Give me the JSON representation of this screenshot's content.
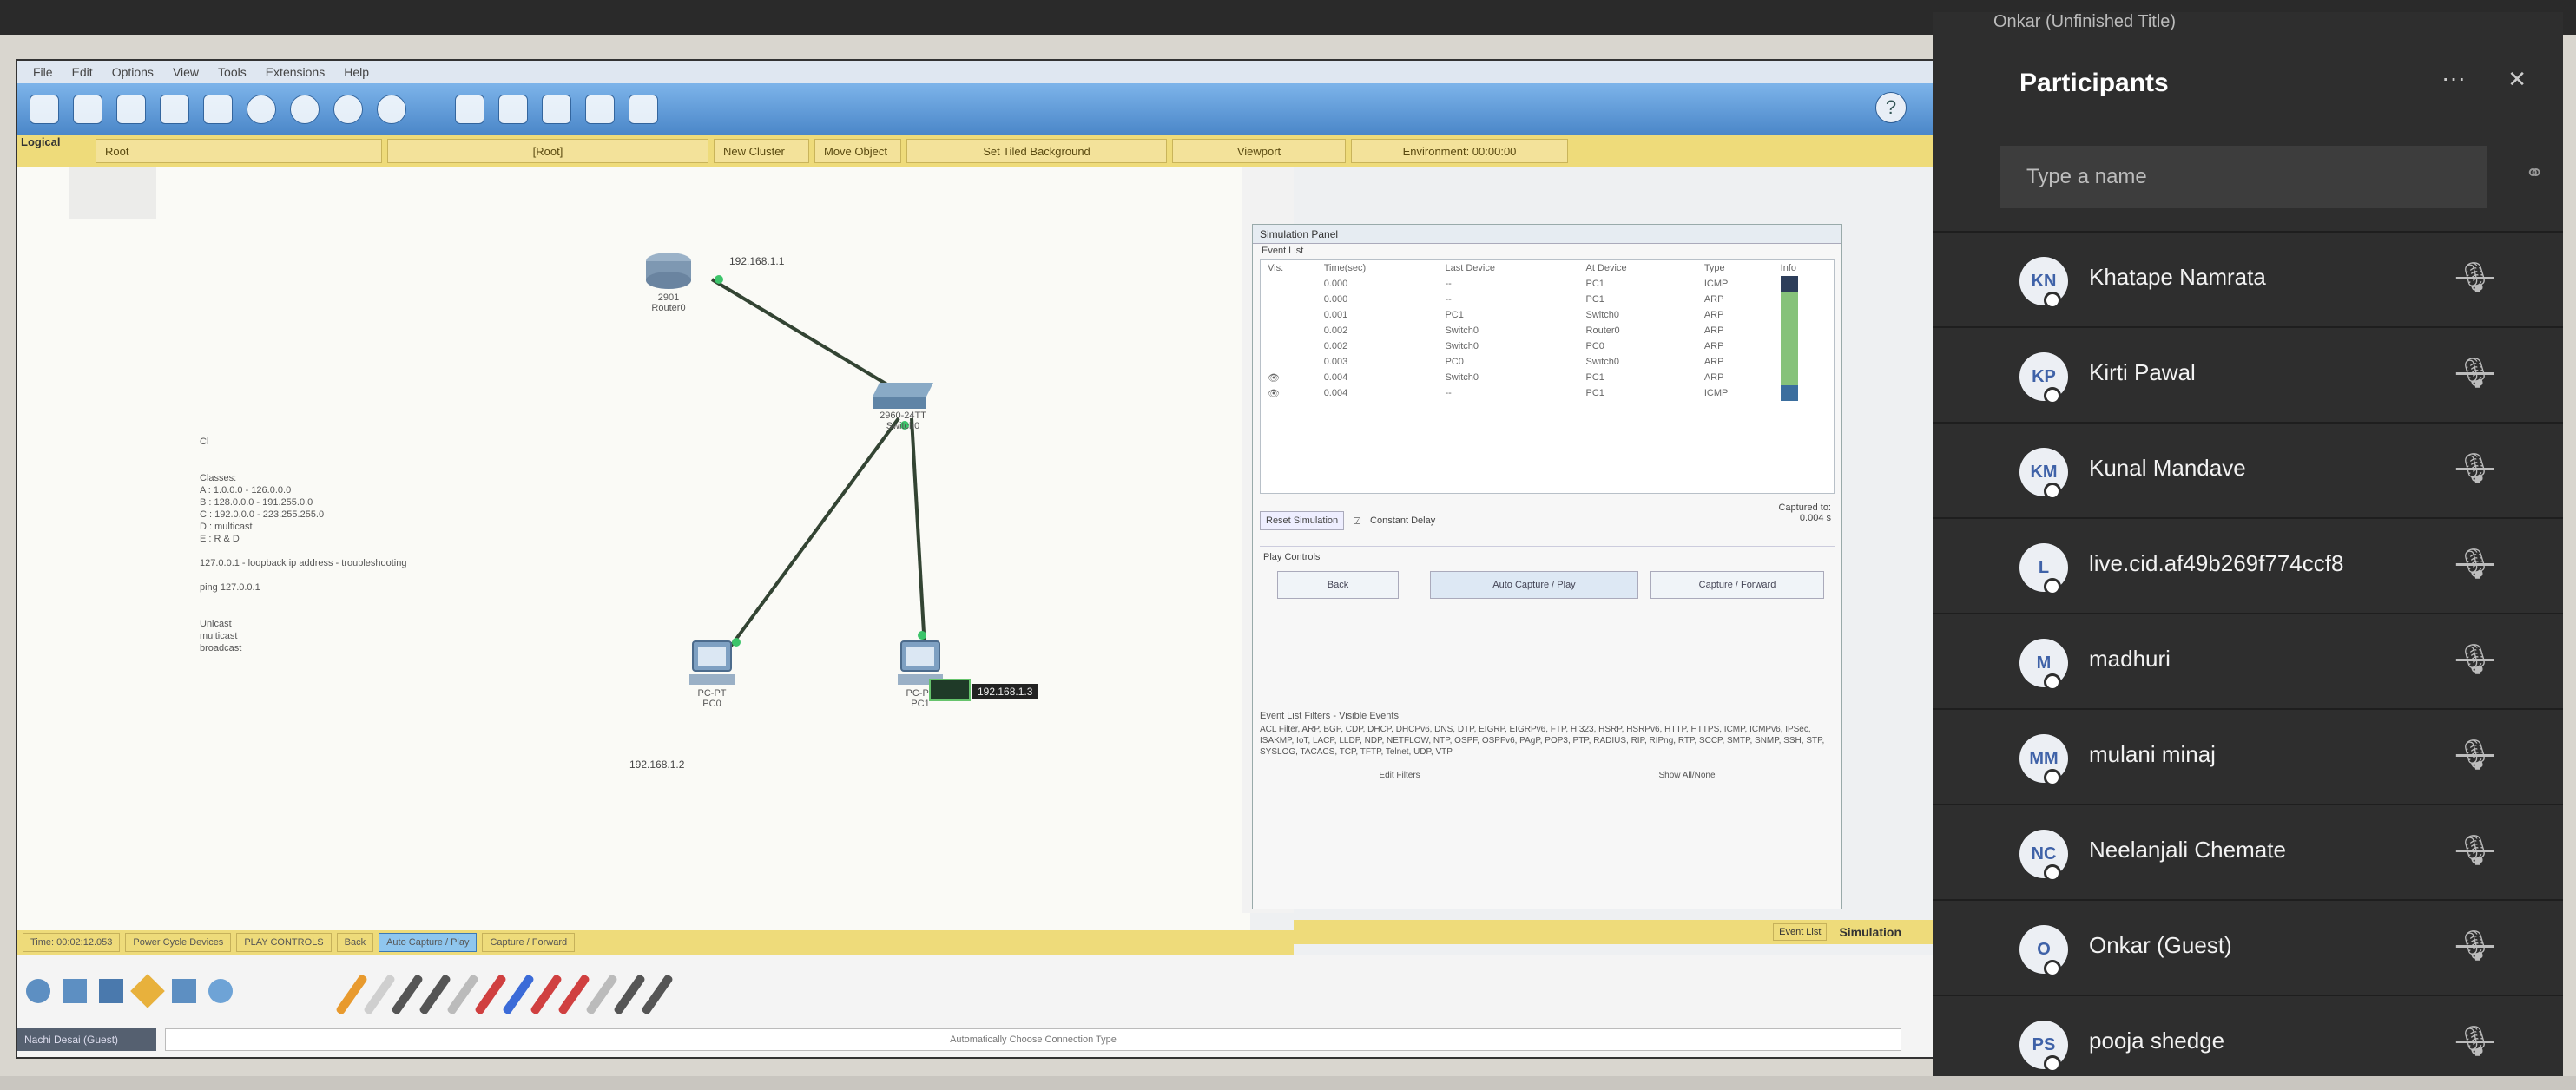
{
  "packet_tracer": {
    "menu": [
      "File",
      "Edit",
      "Options",
      "View",
      "Tools",
      "Extensions",
      "Help"
    ],
    "logical_label": "Logical",
    "toolbar_segments": [
      "Root",
      "[Root]",
      "New Cluster",
      "Move Object",
      "Set Tiled Background",
      "Viewport",
      "Environment: 00:00:00"
    ],
    "devices": {
      "router_model": "2901",
      "router_name": "Router0",
      "router_ip": "192.168.1.1",
      "switch_model": "2960-24TT",
      "switch_name": "Switch0",
      "pc0_model": "PC-PT",
      "pc0_name": "PC0",
      "pc0_ip": "192.168.1.2",
      "pc1_model": "PC-PT",
      "pc1_name": "PC1",
      "pc1_ip": "192.168.1.3"
    },
    "notes_text": "Cl\n\n\nClasses:\nA : 1.0.0.0 - 126.0.0.0\nB : 128.0.0.0 - 191.255.0.0\nC : 192.0.0.0 - 223.255.255.0\nD : multicast\nE : R & D\n\n127.0.0.1 - loopback ip address - troubleshooting\n\nping 127.0.0.1\n\n\nUnicast\nmulticast\nbroadcast",
    "simulation_panel": {
      "title": "Simulation Panel",
      "event_list_label": "Event List",
      "columns": [
        "Vis.",
        "Time(sec)",
        "Last Device",
        "At Device",
        "Type",
        "Info"
      ],
      "events": [
        {
          "vis": "",
          "time": "0.000",
          "last": "--",
          "at": "PC1",
          "type": "ICMP",
          "color": "#2d3e5a"
        },
        {
          "vis": "",
          "time": "0.000",
          "last": "--",
          "at": "PC1",
          "type": "ARP",
          "color": "#86c27a"
        },
        {
          "vis": "",
          "time": "0.001",
          "last": "PC1",
          "at": "Switch0",
          "type": "ARP",
          "color": "#86c27a"
        },
        {
          "vis": "",
          "time": "0.002",
          "last": "Switch0",
          "at": "Router0",
          "type": "ARP",
          "color": "#86c27a"
        },
        {
          "vis": "",
          "time": "0.002",
          "last": "Switch0",
          "at": "PC0",
          "type": "ARP",
          "color": "#86c27a"
        },
        {
          "vis": "",
          "time": "0.003",
          "last": "PC0",
          "at": "Switch0",
          "type": "ARP",
          "color": "#86c27a"
        },
        {
          "vis": "eye",
          "time": "0.004",
          "last": "Switch0",
          "at": "PC1",
          "type": "ARP",
          "color": "#86c27a"
        },
        {
          "vis": "eye",
          "time": "0.004",
          "last": "--",
          "at": "PC1",
          "type": "ICMP",
          "color": "#3b6e9e"
        }
      ],
      "reset_label": "Reset Simulation",
      "constant_delay_label": "Constant Delay",
      "captured_label": "Captured to:",
      "captured_value": "0.004 s",
      "play_controls_label": "Play Controls",
      "back_label": "Back",
      "auto_capture_label": "Auto Capture / Play",
      "capture_forward_label": "Capture / Forward",
      "filters_title": "Event List Filters - Visible Events",
      "filters_text": "ACL Filter, ARP, BGP, CDP, DHCP, DHCPv6, DNS, DTP, EIGRP, EIGRPv6, FTP, H.323, HSRP, HSRPv6, HTTP, HTTPS, ICMP, ICMPv6, IPSec, ISAKMP, IoT, LACP, LLDP, NDP, NETFLOW, NTP, OSPF, OSPFv6, PAgP, POP3, PTP, RADIUS, RIP, RIPng, RTP, SCCP, SMTP, SNMP, SSH, STP, SYSLOG, TACACS, TCP, TFTP, Telnet, UDP, VTP",
      "edit_filters_label": "Edit Filters",
      "show_all_label": "Show All/None"
    },
    "bottom_strip": {
      "time_label": "Time: 00:02:12.053",
      "power_cycle_label": "Power Cycle Devices",
      "play_controls_label": "PLAY CONTROLS",
      "back_label": "Back",
      "auto_capture_label": "Auto Capture / Play",
      "capture_forward_label": "Capture / Forward",
      "event_list_label": "Event List",
      "simulation_label": "Simulation"
    },
    "bottom_left_label": "Nachi Desai (Guest)",
    "connection_type_label": "Automatically Choose Connection Type"
  },
  "participants_panel": {
    "meeting_title": "Onkar (Unfinished Title)",
    "title": "Participants",
    "search_placeholder": "Type a name",
    "participants": [
      {
        "initials": "KN",
        "name": "Khatape Namrata"
      },
      {
        "initials": "KP",
        "name": "Kirti Pawal"
      },
      {
        "initials": "KM",
        "name": "Kunal Mandave"
      },
      {
        "initials": "L",
        "name": "live.cid.af49b269f774ccf8"
      },
      {
        "initials": "M",
        "name": "madhuri"
      },
      {
        "initials": "MM",
        "name": "mulani minaj"
      },
      {
        "initials": "NC",
        "name": "Neelanjali Chemate"
      },
      {
        "initials": "O",
        "name": "Onkar (Guest)"
      },
      {
        "initials": "PS",
        "name": "pooja shedge"
      }
    ]
  },
  "colors": {
    "teams_bg": "#2e2e2e",
    "pt_toolbar": "#4a86c8",
    "pt_yellow": "#eedb7a",
    "avatar_text": "#3f62a8"
  }
}
